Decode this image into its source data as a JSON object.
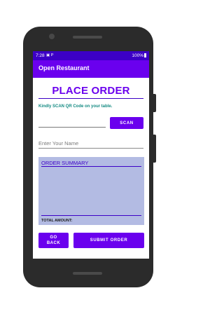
{
  "status_bar": {
    "time": "7:28",
    "icons": "▣ P",
    "battery": "100%"
  },
  "app_bar": {
    "title": "Open Restaurant"
  },
  "main": {
    "title": "PLACE ORDER",
    "scan_hint": "Kindly SCAN QR Code on your table.",
    "scan_button": "SCAN",
    "name_placeholder": "Enter Your Name",
    "summary_title": "ORDER SUMMARY",
    "total_amount_label": "TOTAL AMOUNT:"
  },
  "actions": {
    "go_back": "GO BACK",
    "submit_order": "SUBMIT ORDER"
  },
  "colors": {
    "primary": "#6a00ee",
    "primary_dark": "#3c00c6",
    "accent_text": "#138a82",
    "summary_background": "#b3bbe3"
  }
}
